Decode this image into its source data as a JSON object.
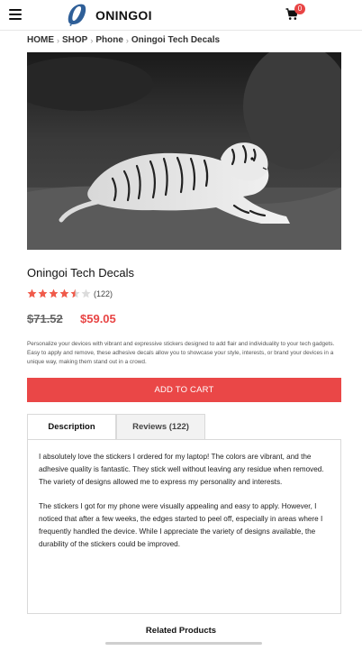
{
  "header": {
    "logo_text": "ONINGOI",
    "cart_count": "0"
  },
  "breadcrumb": [
    "HOME",
    "SHOP",
    "Phone",
    "Oningoi Tech Decals"
  ],
  "product": {
    "title": "Oningoi Tech Decals",
    "rating": 4.5,
    "rating_max": 5,
    "review_count": "(122)",
    "price_old": "$71.52",
    "price_new": "$59.05",
    "description": "Personalize your devices with vibrant and expressive stickers designed to add flair and individuality to your tech gadgets. Easy to apply and remove, these adhesive decals allow you to showcase your style, interests, or brand your devices in a unique way, making them stand out in a crowd.",
    "add_to_cart_label": "ADD TO CART"
  },
  "tabs": [
    {
      "label": "Description",
      "active": true
    },
    {
      "label": "Reviews (122)",
      "active": false
    }
  ],
  "reviews": [
    "I absolutely love the stickers I ordered for my laptop! The colors are vibrant, and the adhesive quality is fantastic. They stick well without leaving any residue when removed. The variety of designs allowed me to express my personality and interests.",
    "The stickers I got for my phone were visually appealing and easy to apply. However, I noticed that after a few weeks, the edges started to peel off, especially in areas where I frequently handled the device. While I appreciate the variety of designs available, the durability of the stickers could be improved."
  ],
  "related": {
    "title": "Related Products"
  },
  "colors": {
    "accent": "#e84545",
    "button": "#ea4747",
    "logo_blue": "#2f5f98"
  },
  "icons": {
    "menu": "hamburger-icon",
    "logo": "logo-icon",
    "cart": "cart-icon",
    "star": "star-icon",
    "breadcrumb_separator": "chevron-right-icon"
  }
}
